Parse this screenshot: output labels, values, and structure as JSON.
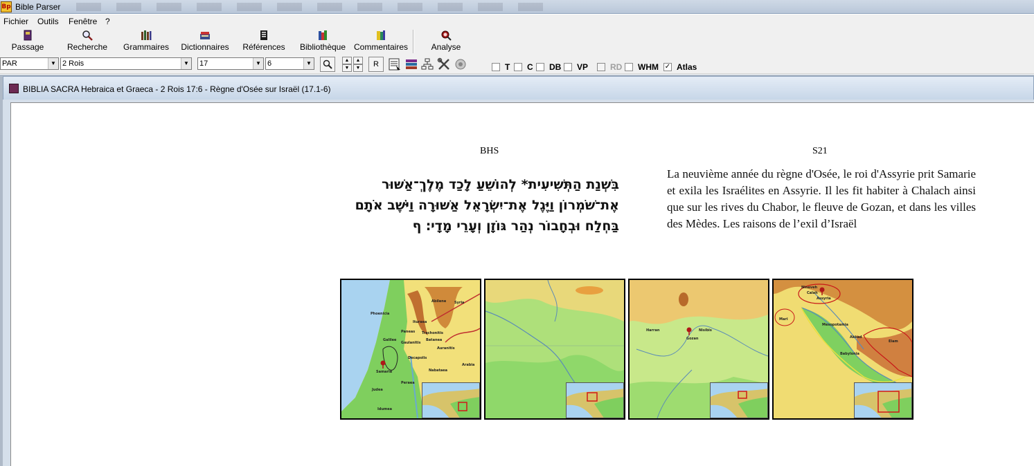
{
  "window": {
    "title": "Bible Parser",
    "icon": "bp-app-icon"
  },
  "menu": {
    "items": [
      "Fichier",
      "Outils",
      "Fenêtre",
      "?"
    ]
  },
  "toolbar": {
    "buttons": [
      {
        "label": "Passage",
        "icon": "book-icon"
      },
      {
        "label": "Recherche",
        "icon": "search-icon"
      },
      {
        "label": "Grammaires",
        "icon": "books-icon"
      },
      {
        "label": "Dictionnaires",
        "icon": "dictionary-icon"
      },
      {
        "label": "Références",
        "icon": "references-icon"
      },
      {
        "label": "Bibliothèque",
        "icon": "library-icon"
      },
      {
        "label": "Commentaires",
        "icon": "commentary-icon"
      },
      {
        "label": "Analyse",
        "icon": "analysis-icon"
      }
    ]
  },
  "selectors": {
    "version": "PAR",
    "book": "2 Rois",
    "chapter": "17",
    "verse": "6",
    "r_button": "R",
    "checkboxes": [
      {
        "label": "T",
        "checked": false,
        "enabled": true
      },
      {
        "label": "C",
        "checked": false,
        "enabled": true
      },
      {
        "label": "DB",
        "checked": false,
        "enabled": true
      },
      {
        "label": "VP",
        "checked": false,
        "enabled": true
      },
      {
        "label": "RD",
        "checked": false,
        "enabled": false
      },
      {
        "label": "WHM",
        "checked": false,
        "enabled": true
      },
      {
        "label": "Atlas",
        "checked": true,
        "enabled": true
      }
    ]
  },
  "document": {
    "title": "BIBLIA SACRA Hebraica et Graeca - 2 Rois 17:6 - Règne d'Osée sur Israël (17.1-6)",
    "left_heading": "BHS",
    "right_heading": "S21",
    "hebrew_text": "בִּשְׁנַת הַתְּשִׁיעִית* לְהוֹשֵׁעַ לָכַד מֶלֶךְ־אַשּׁוּר אֶת־שֹׁמְרוֹן וַיֶּגֶל אֶת־יִשְׂרָאֵל אַשּׁוּרָה וַיֹּשֶׁב אֹתָם בַּחְלַח וּבְחָבוֹר נְהַר גּוֹזָן וְעָרֵי מָדָי׃ ף",
    "french_text": "La neuvième année du règne d'Osée, le roi d'Assyrie prit Samarie et exila les Israélites en Assyrie. Il les fit habiter à Chalach ainsi que sur les rives du Chabor, le fleuve de Gozan, et dans les villes des Mèdes. Les raisons de l’exil d’Israël"
  },
  "maps": [
    {
      "name": "samaria-map",
      "labels": [
        "Abilene",
        "Syria",
        "Phoenicia",
        "Ituraea",
        "Trachonitis",
        "Paneas",
        "Batanea",
        "Galilee",
        "Gaulanitis",
        "Auranitis",
        "Decapolis",
        "Samaria",
        "Nabataea",
        "Arabia",
        "Peraea",
        "Judea",
        "Idumea"
      ]
    },
    {
      "name": "river-map-1",
      "labels": []
    },
    {
      "name": "gozan-map",
      "labels": [
        "Gozan",
        "Nisibis",
        "Harran"
      ]
    },
    {
      "name": "assyria-map",
      "labels": [
        "Nineveh",
        "Calah",
        "Assyria",
        "Mari",
        "Mesopotamia",
        "Akkad",
        "Babylonia",
        "Elam"
      ]
    }
  ]
}
